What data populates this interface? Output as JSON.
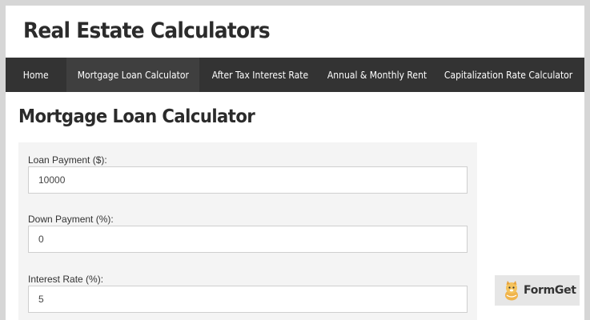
{
  "site": {
    "title": "Real Estate Calculators"
  },
  "nav": {
    "items": [
      {
        "label": "Home"
      },
      {
        "label": "Mortgage Loan Calculator"
      },
      {
        "label": "After Tax Interest Rate"
      },
      {
        "label": "Annual & Monthly Rent"
      },
      {
        "label": "Capitalization Rate Calculator"
      }
    ],
    "active": "Mortgage Loan Calculator"
  },
  "main": {
    "heading": "Mortgage Loan Calculator",
    "fields": [
      {
        "label": "Loan Payment ($):",
        "value": "10000"
      },
      {
        "label": "Down Payment (%):",
        "value": "0"
      },
      {
        "label": "Interest Rate (%):",
        "value": "5"
      }
    ]
  },
  "badge": {
    "text": "FormGet"
  },
  "colors": {
    "nav_background": "#333333",
    "nav_active": "#3f3f3f",
    "panel_background": "#f4f4f4",
    "frame": "#d6d6d6"
  }
}
